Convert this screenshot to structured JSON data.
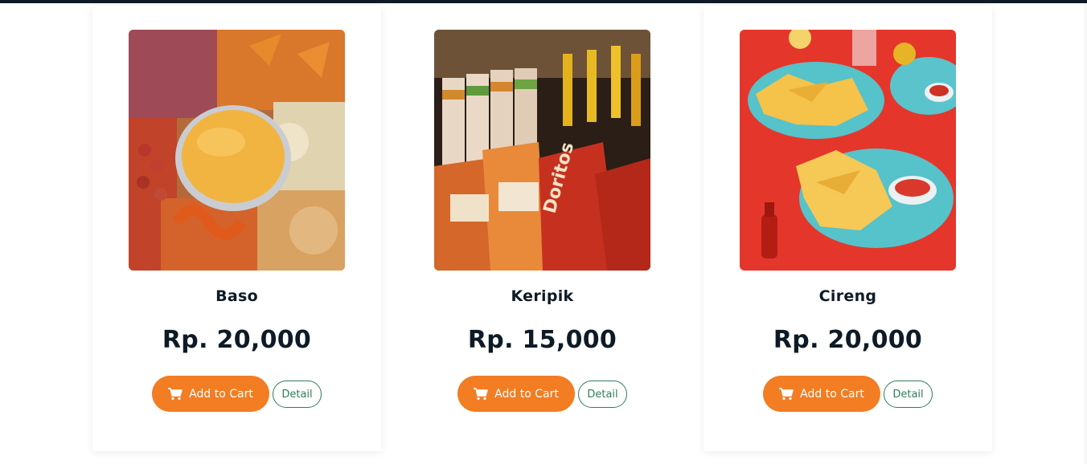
{
  "products": [
    {
      "name": "Baso",
      "price": "Rp. 20,000",
      "cart_label": "Add to Cart",
      "detail_label": "Detail"
    },
    {
      "name": "Keripik",
      "price": "Rp. 15,000",
      "cart_label": "Add to Cart",
      "detail_label": "Detail"
    },
    {
      "name": "Cireng",
      "price": "Rp. 20,000",
      "cart_label": "Add to Cart",
      "detail_label": "Detail"
    }
  ],
  "colors": {
    "accent": "#f27d22",
    "detail_outline": "#2e7d57",
    "text": "#0e1b26",
    "topbar": "#0e1b26"
  },
  "icons": {
    "cart": "shopping-cart-icon"
  }
}
